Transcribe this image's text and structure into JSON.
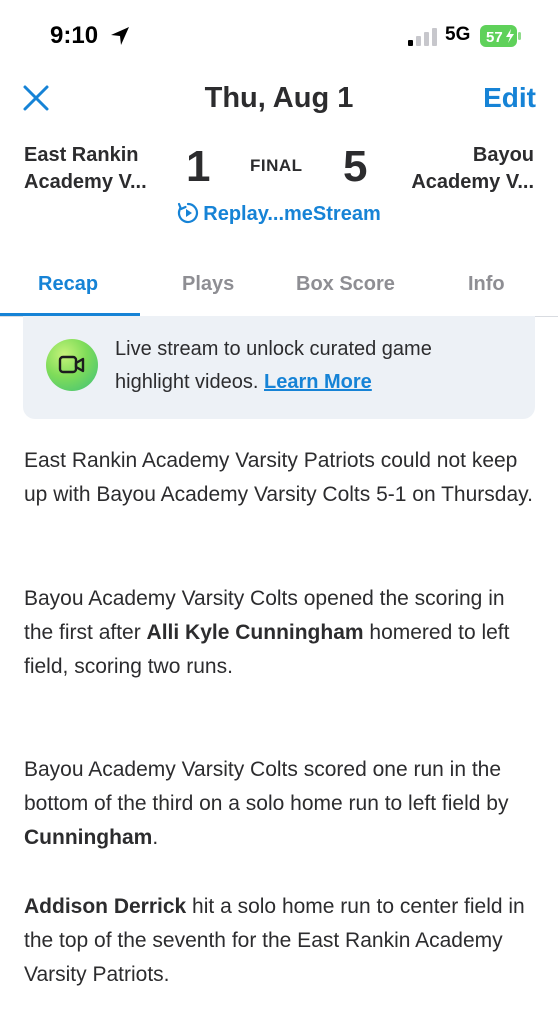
{
  "status_bar": {
    "time": "9:10",
    "network": "5G",
    "battery_level": "57",
    "location_icon": "location-arrow-icon",
    "signal_icon": "cellular-signal-icon"
  },
  "nav": {
    "close_icon": "close-icon",
    "title": "Thu, Aug 1",
    "edit_label": "Edit"
  },
  "game": {
    "home_team_line1": "East Rankin",
    "home_team_line2": "Academy V...",
    "home_score": "1",
    "status": "FINAL",
    "away_score": "5",
    "away_team_line1": "Bayou",
    "away_team_line2": "Academy V...",
    "replay_label": "Replay...meStream",
    "replay_icon": "replay-icon"
  },
  "tabs": [
    {
      "label": "Recap",
      "active": true
    },
    {
      "label": "Plays",
      "active": false
    },
    {
      "label": "Box Score",
      "active": false
    },
    {
      "label": "Info",
      "active": false
    }
  ],
  "banner": {
    "icon": "video-camera-icon",
    "text_line1": "Live stream to unlock curated game",
    "text_line2": "highlight videos.",
    "link": "Learn More"
  },
  "recap": {
    "p1": "East Rankin Academy Varsity Patriots could not keep up with Bayou Academy Varsity Colts 5-1 on Thursday.",
    "p2_a": "Bayou Academy Varsity Colts opened the scoring in the first after ",
    "p2_name": "Alli Kyle Cunningham",
    "p2_b": " homered to left field, scoring two runs.",
    "p3_a": "Bayou Academy Varsity Colts scored one run in the bottom of the third on a solo home run to left field by ",
    "p3_name": "Cunningham",
    "p3_b": ".",
    "p4_name": "Addison Derrick",
    "p4_b": " hit a solo home run to center field in the top of the seventh for the East Rankin Academy Varsity Patriots."
  },
  "colors": {
    "accent": "#1683d6",
    "text": "#2c2c2e",
    "muted": "#8e8e93",
    "banner_bg": "#edf1f6",
    "battery_green": "#5fd15a"
  }
}
